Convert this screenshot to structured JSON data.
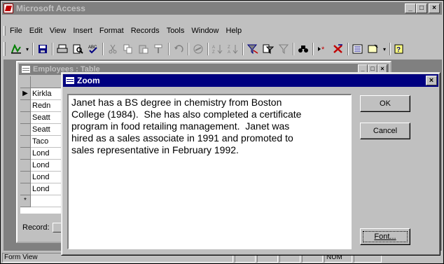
{
  "app": {
    "title": "Microsoft Access",
    "window_buttons": [
      "_",
      "□",
      "×"
    ]
  },
  "menu": [
    "File",
    "Edit",
    "View",
    "Insert",
    "Format",
    "Records",
    "Tools",
    "Window",
    "Help"
  ],
  "toolbar_icons": [
    "view-icon",
    "dropdown-icon",
    "save-icon",
    "print-icon",
    "print-preview-icon",
    "spelling-icon",
    "cut-icon",
    "copy-icon",
    "paste-icon",
    "format-painter-icon",
    "undo-icon",
    "hyperlink-icon",
    "sort-ascending-icon",
    "sort-descending-icon",
    "filter-by-selection-icon",
    "filter-by-form-icon",
    "apply-filter-icon",
    "find-icon",
    "new-record-icon",
    "delete-record-icon",
    "properties-icon",
    "new-object-icon",
    "help-icon"
  ],
  "table_window": {
    "title": "Employees : Table",
    "rows": [
      "Kirkla",
      "Redn",
      "Seatt",
      "Seatt",
      "Taco",
      "Lond",
      "Lond",
      "Lond",
      "Lond"
    ],
    "new_row_marker": "*",
    "current_row_marker": "▶",
    "record_label": "Record:"
  },
  "status": {
    "left": "Form View",
    "num": "NUM"
  },
  "zoom_dialog": {
    "title": "Zoom",
    "text": "Janet has a BS degree in chemistry from Boston\nCollege (1984).  She has also completed a certificate\nprogram in food retailing management.  Janet was\nhired as a sales associate in 1991 and promoted to\nsales representative in February 1992.",
    "ok_label": "OK",
    "cancel_label": "Cancel",
    "font_label": "Font..."
  }
}
